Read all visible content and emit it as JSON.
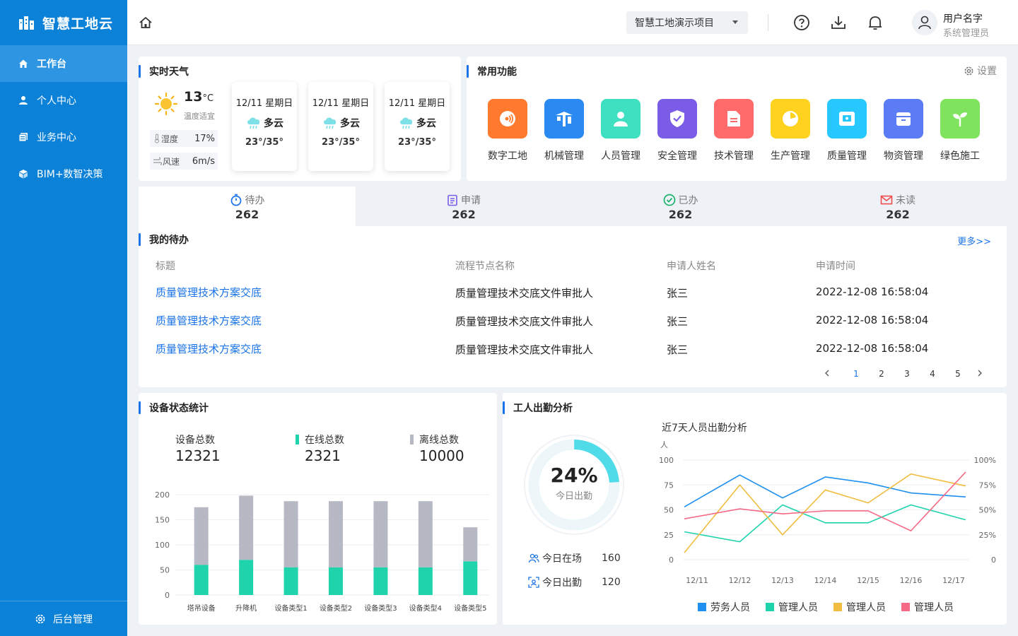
{
  "app": {
    "title": "智慧工地云"
  },
  "sidebar": {
    "items": [
      {
        "label": "工作台",
        "icon": "home-icon",
        "active": true
      },
      {
        "label": "个人中心",
        "icon": "user-icon"
      },
      {
        "label": "业务中心",
        "icon": "business-icon"
      },
      {
        "label": "BIM+数智决策",
        "icon": "cube-icon"
      }
    ],
    "bottom": "后台管理"
  },
  "header": {
    "project": "智慧工地演示项目",
    "user_name": "用户名字",
    "user_role": "系统管理员"
  },
  "weather": {
    "title": "实时天气",
    "temp": "13",
    "unit": "°C",
    "comfort": "温度适宜",
    "humidity_label": "湿度",
    "humidity": "17%",
    "wind_label": "风速",
    "wind": "6m/s",
    "forecast": [
      {
        "date": "12/11 星期日",
        "cond": "多云",
        "range": "23°/35°"
      },
      {
        "date": "12/11 星期日",
        "cond": "多云",
        "range": "23°/35°"
      },
      {
        "date": "12/11 星期日",
        "cond": "多云",
        "range": "23°/35°"
      }
    ]
  },
  "functions": {
    "title": "常用功能",
    "settings": "设置",
    "items": [
      {
        "label": "数字工地",
        "color": "#ff7a2f"
      },
      {
        "label": "机械管理",
        "color": "#2b8af2"
      },
      {
        "label": "人员管理",
        "color": "#3ee0c1"
      },
      {
        "label": "安全管理",
        "color": "#7a5ce6"
      },
      {
        "label": "技术管理",
        "color": "#ff6b6b"
      },
      {
        "label": "生产管理",
        "color": "#ffd21f"
      },
      {
        "label": "质量管理",
        "color": "#27c8ff"
      },
      {
        "label": "物资管理",
        "color": "#5b7cf5"
      },
      {
        "label": "绿色施工",
        "color": "#7fe35d"
      }
    ]
  },
  "tabs": [
    {
      "label": "待办",
      "count": "262",
      "color": "#1a73e8"
    },
    {
      "label": "申请",
      "count": "262",
      "color": "#7a5ce6"
    },
    {
      "label": "已办",
      "count": "262",
      "color": "#19b46a"
    },
    {
      "label": "未读",
      "count": "262",
      "color": "#f04b4b"
    }
  ],
  "todo": {
    "title": "我的待办",
    "more": "更多>>",
    "headers": [
      "标题",
      "流程节点名称",
      "申请人姓名",
      "申请时间"
    ],
    "rows": [
      [
        "质量管理技术方案交底",
        "质量管理技术交底文件审批人",
        "张三",
        "2022-12-08 16:58:04"
      ],
      [
        "质量管理技术方案交底",
        "质量管理技术交底文件审批人",
        "张三",
        "2022-12-08 16:58:04"
      ],
      [
        "质量管理技术方案交底",
        "质量管理技术交底文件审批人",
        "张三",
        "2022-12-08 16:58:04"
      ]
    ],
    "pages": [
      "1",
      "2",
      "3",
      "4",
      "5"
    ],
    "current_page": "1"
  },
  "device": {
    "title": "设备状态统计",
    "total_label": "设备总数",
    "total": "12321",
    "online_label": "在线总数",
    "online": "2321",
    "offline_label": "离线总数",
    "offline": "10000",
    "online_color": "#1fd4ad",
    "offline_color": "#b6b8c3"
  },
  "attendance": {
    "title": "工人出勤分析",
    "percent": "24%",
    "percent_value": 24,
    "percent_label": "今日出勤",
    "onsite_label": "今日在场",
    "onsite": "160",
    "present_label": "今日出勤",
    "present": "120",
    "chart_title": "近7天人员出勤分析"
  },
  "chart_data": [
    {
      "type": "bar",
      "categories": [
        "塔吊设备",
        "升降机",
        "设备类型1",
        "设备类型2",
        "设备类型3",
        "设备类型4",
        "设备类型5"
      ],
      "series": [
        {
          "name": "在线总数",
          "values": [
            60,
            70,
            55,
            55,
            55,
            55,
            67
          ]
        },
        {
          "name": "离线总数",
          "values": [
            115,
            128,
            132,
            132,
            132,
            132,
            68
          ]
        }
      ],
      "stacked": true,
      "ylim": [
        0,
        200
      ],
      "yticks": [
        0,
        50,
        100,
        150,
        200
      ]
    },
    {
      "type": "line",
      "title": "近7天人员出勤分析",
      "ylabel": "人",
      "x": [
        "12/11",
        "12/12",
        "12/13",
        "12/14",
        "12/15",
        "12/16",
        "12/17"
      ],
      "ylim": [
        0,
        100
      ],
      "yticks": [
        0,
        25,
        50,
        75,
        100
      ],
      "y2ticks": [
        "0",
        "25%",
        "50%",
        "75%",
        "100%"
      ],
      "series": [
        {
          "name": "劳务人员",
          "color": "#1f8ff0",
          "values": [
            53,
            85,
            62,
            83,
            77,
            67,
            63
          ]
        },
        {
          "name": "管理人员",
          "color": "#1fd4ad",
          "values": [
            28,
            18,
            55,
            37,
            37,
            55,
            40
          ]
        },
        {
          "name": "管理人员",
          "color": "#f0bd40",
          "values": [
            7,
            75,
            25,
            70,
            57,
            86,
            74
          ]
        },
        {
          "name": "管理人员",
          "color": "#f56a86",
          "values": [
            41,
            51,
            46,
            49,
            49,
            29,
            88
          ]
        }
      ]
    }
  ]
}
